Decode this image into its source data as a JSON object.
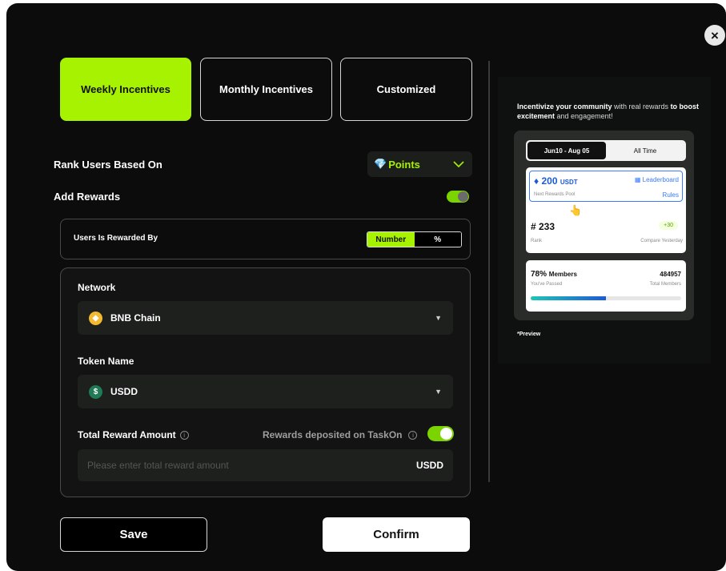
{
  "close": {
    "glyph": "×"
  },
  "tabs": [
    {
      "label": "Weekly Incentives",
      "active": true
    },
    {
      "label": "Monthly Incentives",
      "active": false
    },
    {
      "label": "Customized",
      "active": false
    }
  ],
  "rank": {
    "label": "Rank Users Based On",
    "select_value": "Points",
    "select_icon": "diamond-icon"
  },
  "add_rewards": {
    "label": "Add Rewards",
    "enabled": true
  },
  "rewarded_by": {
    "label": "Users Is Rewarded By",
    "options": [
      "Number",
      "%"
    ],
    "selected": "Number"
  },
  "network": {
    "label": "Network",
    "value": "BNB Chain",
    "icon": "bnb-chain-icon",
    "icon_glyph": "◆"
  },
  "token": {
    "label": "Token Name",
    "value": "USDD",
    "icon": "usdd-coin-icon",
    "icon_glyph": "$"
  },
  "reward_amount": {
    "label": "Total Reward Amount",
    "deposit_label": "Rewards deposited on TaskOn",
    "deposit_enabled": true,
    "placeholder": "Please enter total reward amount",
    "unit": "USDD"
  },
  "actions": {
    "save": "Save",
    "confirm": "Confirm"
  },
  "preview": {
    "desc_bold": "Incentivize your community",
    "desc_rest": " with real rewards ",
    "desc_bold2": "to boost excitement",
    "desc_rest2": " and engagement!",
    "tabs": [
      "Jun10 - Aug 05",
      "All Time"
    ],
    "pool_amount": "200",
    "pool_unit": "USDT",
    "pool_label": "Next Rewards Pool",
    "leaderboard": "Leaderboard",
    "rules": "Rules",
    "rank_value": "# 233",
    "rank_label": "Rank",
    "delta": "+30",
    "compare_label": "Compare Yesterday",
    "passed_pct": "78%",
    "passed_word": "Members",
    "passed_label": "You've Passed",
    "total_members": "484957",
    "total_label": "Total Members",
    "progress": 0.5,
    "note": "*Preview"
  },
  "colors": {
    "accent": "#a6f200",
    "background": "#0b0c0b",
    "link": "#3a7bff"
  }
}
